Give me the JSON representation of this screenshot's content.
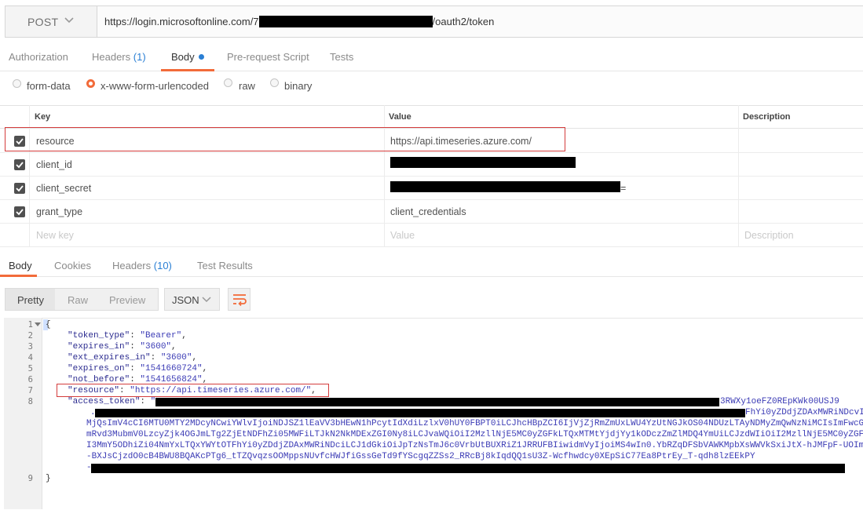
{
  "request": {
    "method": "POST",
    "url_prefix": "https://login.microsoftonline.com/7",
    "url_suffix": "/oauth2/token"
  },
  "request_tabs": {
    "authorization": "Authorization",
    "headers": "Headers",
    "headers_count": "(1)",
    "body": "Body",
    "prerequest": "Pre-request Script",
    "tests": "Tests"
  },
  "body_modes": {
    "form_data": "form-data",
    "urlencoded": "x-www-form-urlencoded",
    "raw": "raw",
    "binary": "binary",
    "selected": "x-www-form-urlencoded"
  },
  "params_table": {
    "headers": {
      "key": "Key",
      "value": "Value",
      "description": "Description"
    },
    "rows": [
      {
        "key": "resource",
        "value": "https://api.timeseries.azure.com/",
        "checked": true
      },
      {
        "key": "client_id",
        "value": "",
        "checked": true
      },
      {
        "key": "client_secret",
        "value": "=",
        "checked": true
      },
      {
        "key": "grant_type",
        "value": "client_credentials",
        "checked": true
      }
    ],
    "placeholder_key": "New key",
    "placeholder_value": "Value",
    "placeholder_description": "Description"
  },
  "response_tabs": {
    "body": "Body",
    "cookies": "Cookies",
    "headers": "Headers",
    "headers_count": "(10)",
    "test_results": "Test Results"
  },
  "response_toolbar": {
    "pretty": "Pretty",
    "raw": "Raw",
    "preview": "Preview",
    "format": "JSON"
  },
  "response_body": {
    "line_numbers": [
      "1",
      "2",
      "3",
      "4",
      "5",
      "6",
      "7",
      "8",
      "9"
    ],
    "open_brace": "{",
    "close_brace": "}",
    "lines": [
      {
        "key": "\"token_type\"",
        "value": "\"Bearer\""
      },
      {
        "key": "\"expires_in\"",
        "value": "\"3600\""
      },
      {
        "key": "\"ext_expires_in\"",
        "value": "\"3600\""
      },
      {
        "key": "\"expires_on\"",
        "value": "\"1541660724\""
      },
      {
        "key": "\"not_before\"",
        "value": "\"1541656824\""
      },
      {
        "key": "\"resource\"",
        "value": "\"https://api.timeseries.azure.com/\""
      }
    ],
    "access_token_key": "\"access_token\"",
    "access_token_quote": "\"",
    "token_line1_tail": "3RWXy1oeFZ0REpKWk00USJ9",
    "token_line2": ".",
    "token_line2_tail": "FhYi0yZDdjZDAxMWRiNDcvI",
    "token_line3": "MjQsImV4cCI6MTU0MTY2MDcyNCwiYWlvIjoiNDJSZ1lEaVV3bHEwN1hPcytIdXdiLzlxV0hUY0FBPT0iLCJhcHBpZCI6IjVjZjRmZmUxLWU4YzUtNGJkOS04NDUzLTAyNDMyZmQwNzNiMCIsImFwcG",
    "token_line4": "mRvd3MubmV0LzcyZjk4OGJmLTg2ZjEtNDFhZi05MWFiLTJkN2NkMDExZGI0Ny8iLCJvaWQiOiI2MzllNjE5MC0yZGFkLTQxMTMtYjdjYy1kODczZmZlMDQ4YmUiLCJzdWIiOiI2MzllNjE5MC0yZGF",
    "token_line5": "I3MmY5ODhiZi04NmYxLTQxYWYtOTFhYi0yZDdjZDAxMWRiNDciLCJ1dGkiOiJpTzNsTmJ6c0VrbUtBUXRiZ1JRRUFBIiwidmVyIjoiMS4wIn0.YbRZqDFSbVAWKMpbXsWWVkSxiJtX-hJMFpF-UOIm",
    "token_line6": "-BXJsCjzdO0cB4BWU8BQAKcPTg6_tTZQvqzsOOMppsNUvfcHWJfiGssGeTd9fYScgqZZSs2_RRcBj8kIqdQQ1sU3Z-Wcfhwdcy0XEpSiC77Ea8PtrEy_T-qdh8lzEEkPY",
    "token_line7": "-"
  },
  "colors": {
    "accent": "#f26b3a",
    "highlight_box": "#d43c3c",
    "link_blue": "#2a7fd4"
  }
}
